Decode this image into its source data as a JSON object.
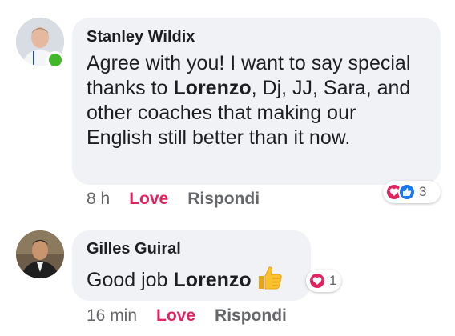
{
  "comments": [
    {
      "author": "Stanley Wildix",
      "text_parts": [
        "Agree with you! I want to say special thanks to ",
        "Lorenzo",
        ", Dj, JJ, Sara, and other coaches that making our English still better than it now."
      ],
      "reaction_count": "3",
      "reactions": [
        "love-icon",
        "like-icon"
      ],
      "time": "8 h",
      "love_label": "Love",
      "reply_label": "Rispondi",
      "online": true
    },
    {
      "author": "Gilles Guiral",
      "text_parts": [
        "Good job ",
        "Lorenzo",
        " "
      ],
      "emoji": "thumbs-up-emoji",
      "reaction_count": "1",
      "reactions": [
        "love-icon"
      ],
      "time": "16 min",
      "love_label": "Love",
      "reply_label": "Rispondi",
      "online": false
    }
  ],
  "colors": {
    "bubble": "#f0f2f5",
    "love": "#e0245e",
    "like": "#1877f2",
    "online": "#42b72a",
    "muted": "#65676b"
  }
}
